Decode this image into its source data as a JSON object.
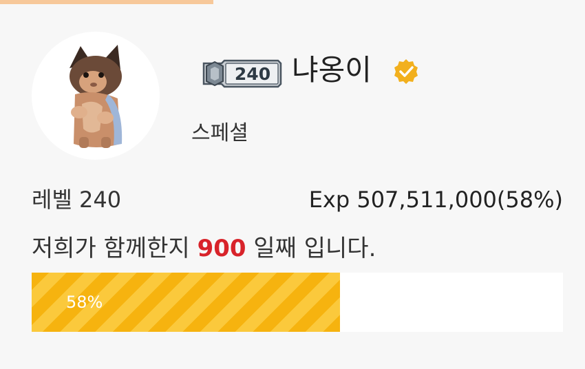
{
  "profile": {
    "nickname": "냐옹이",
    "level_badge": "240",
    "user_type": "스페셜",
    "avatar_icon": "cat-avatar",
    "verified_icon": "verified-badge-icon"
  },
  "stats": {
    "level_label": "레벨 240",
    "exp_label": "Exp 507,511,000(58%)"
  },
  "days": {
    "prefix": "저희가 함께한지 ",
    "count": "900",
    "suffix": " 일째 입니다."
  },
  "progress": {
    "value": 0.58,
    "label": "58%"
  },
  "colors": {
    "accent_orange": "#f7c89a",
    "progress_yellow": "#f6b30f",
    "days_red": "#d8232a",
    "verified_gold": "#f2b01e"
  }
}
